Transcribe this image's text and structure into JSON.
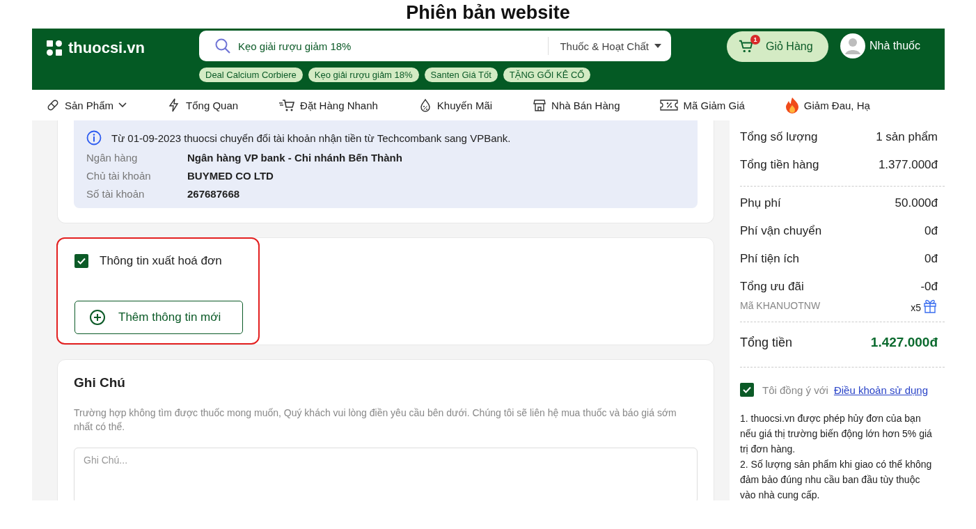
{
  "page_title": "Phiên bản website",
  "header": {
    "logo": "thuocsi.vn",
    "search": {
      "value": "Kẹo giải rượu giảm 18%",
      "category": "Thuốc & Hoạt Chất"
    },
    "tags": [
      "Deal Calcium Corbiere",
      "Kẹo giải rượu giảm 18%",
      "Santen Giá Tốt",
      "TẶNG GỐI KÊ CỔ"
    ],
    "cart": {
      "label": "Giỏ Hàng",
      "count": "1"
    },
    "account": "Nhà thuốc"
  },
  "nav": [
    {
      "kind": "pill",
      "label": "Sản Phẩm",
      "dropdown": true
    },
    {
      "kind": "bolt",
      "label": "Tổng Quan",
      "dropdown": false
    },
    {
      "kind": "cart",
      "label": "Đặt Hàng Nhanh",
      "dropdown": false
    },
    {
      "kind": "drop",
      "label": "Khuyến Mãi",
      "dropdown": false
    },
    {
      "kind": "store",
      "label": "Nhà Bán Hàng",
      "dropdown": false
    },
    {
      "kind": "coupon",
      "label": "Mã Giảm Giá",
      "dropdown": false
    },
    {
      "kind": "fire",
      "label": "Giảm Đau, Hạ",
      "dropdown": false
    }
  ],
  "bank_notice": {
    "message": "Từ 01-09-2023 thuocsi chuyển đổi tài khoản nhận tiền từ Techcombank sang VPBank.",
    "details": [
      {
        "label": "Ngân hàng",
        "value": "Ngân hàng VP bank - Chi nhánh Bến Thành"
      },
      {
        "label": "Chủ tài khoản",
        "value": "BUYMED CO LTD"
      },
      {
        "label": "Số tài khoản",
        "value": "267687668"
      }
    ]
  },
  "invoice": {
    "checked": true,
    "label": "Thông tin xuất hoá đơn",
    "add_button": "Thêm thông tin mới"
  },
  "notes": {
    "title": "Ghi Chú",
    "description": "Trường hợp không tìm được thuốc mong muốn, Quý khách vui lòng điền yêu cầu bên dưới. Chúng tôi sẽ liên hệ mua thuốc và báo giá sớm nhất có thể.",
    "placeholder": "Ghi Chú..."
  },
  "summary": {
    "groups": [
      {
        "rows": [
          {
            "kind": "line",
            "label": "Tổng số lượng",
            "value": "1 sản phẩm"
          },
          {
            "kind": "line",
            "label": "Tổng tiền hàng",
            "value": "1.377.000đ"
          }
        ]
      },
      {
        "rows": [
          {
            "kind": "line",
            "label": "Phụ phí",
            "value": "50.000đ"
          },
          {
            "kind": "line",
            "label": "Phí vận chuyển",
            "value": "0đ"
          },
          {
            "kind": "line",
            "label": "Phí tiện ích",
            "value": "0đ"
          },
          {
            "kind": "line",
            "label": "Tổng ưu đãi",
            "value": "-0đ"
          },
          {
            "kind": "promo",
            "label": "Mã KHANUOTNW",
            "value": "x5"
          }
        ]
      },
      {
        "rows": [
          {
            "kind": "total",
            "label": "Tổng tiền",
            "value": "1.427.000đ"
          }
        ]
      }
    ]
  },
  "terms": {
    "checked": true,
    "prefix": "Tôi đồng ý với",
    "link": "Điều khoản sử dụng",
    "notes": [
      "1. thuocsi.vn được phép hủy đơn của bạn nếu giá thị trường biến động lớn hơn 5% giá trị đơn hàng.",
      "2. Số lượng sản phẩm khi giao có thể không đảm bảo đúng nhu cầu ban đầu tùy thuộc vào nhà cung cấp."
    ]
  }
}
